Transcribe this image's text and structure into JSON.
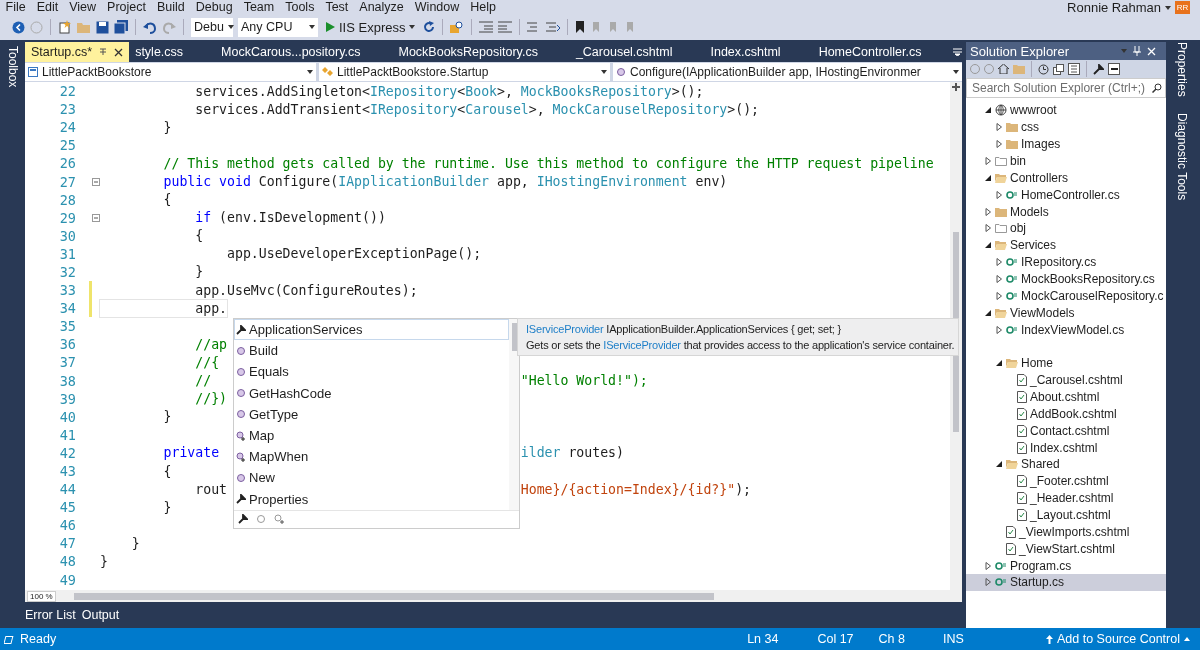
{
  "menu": [
    "File",
    "Edit",
    "View",
    "Project",
    "Build",
    "Debug",
    "Team",
    "Tools",
    "Test",
    "Analyze",
    "Window",
    "Help"
  ],
  "user": {
    "name": "Ronnie Rahman",
    "initials": "RR"
  },
  "toolbar": {
    "configuration": "Debu",
    "platform": "Any CPU",
    "run_target": "IIS Express"
  },
  "left_strip": [
    "Toolbox"
  ],
  "right_strip": [
    "Properties",
    "Diagnostic Tools"
  ],
  "tabs": [
    {
      "label": "Startup.cs*",
      "selected": true
    },
    {
      "label": "style.css",
      "selected": false
    },
    {
      "label": "MockCarous...pository.cs",
      "selected": false
    },
    {
      "label": "MockBooksRepository.cs",
      "selected": false
    },
    {
      "label": "_Carousel.cshtml",
      "selected": false
    },
    {
      "label": "Index.cshtml",
      "selected": false
    },
    {
      "label": "HomeController.cs",
      "selected": false
    }
  ],
  "nav_bar": [
    "LittlePacktBookstore",
    "LittlePacktBookstore.Startup",
    "Configure(IApplicationBuilder app, IHostingEnvironmer"
  ],
  "editor": {
    "zoom": "100 %",
    "lines": [
      {
        "number": "22",
        "changed": false,
        "fold": false,
        "current": false,
        "tokens": [
          {
            "text": "            services.AddSingleton<",
            "kind": "plain"
          },
          {
            "text": "IRepository",
            "kind": "type"
          },
          {
            "text": "<",
            "kind": "plain"
          },
          {
            "text": "Book",
            "kind": "type"
          },
          {
            "text": ">, ",
            "kind": "plain"
          },
          {
            "text": "MockBooksRepository",
            "kind": "type"
          },
          {
            "text": ">();",
            "kind": "plain"
          }
        ]
      },
      {
        "number": "23",
        "changed": false,
        "fold": false,
        "current": false,
        "tokens": [
          {
            "text": "            services.AddTransient<",
            "kind": "plain"
          },
          {
            "text": "IRepository",
            "kind": "type"
          },
          {
            "text": "<",
            "kind": "plain"
          },
          {
            "text": "Carousel",
            "kind": "type"
          },
          {
            "text": ">, ",
            "kind": "plain"
          },
          {
            "text": "MockCarouselRepository",
            "kind": "type"
          },
          {
            "text": ">();",
            "kind": "plain"
          }
        ]
      },
      {
        "number": "24",
        "changed": false,
        "fold": false,
        "current": false,
        "tokens": [
          {
            "text": "        }",
            "kind": "plain"
          }
        ]
      },
      {
        "number": "25",
        "changed": false,
        "fold": false,
        "current": false
      },
      {
        "number": "26",
        "changed": false,
        "fold": false,
        "current": false,
        "tokens": [
          {
            "text": "        // This method gets called by the runtime. Use this method to configure the HTTP request pipeline",
            "kind": "comment"
          }
        ]
      },
      {
        "number": "27",
        "changed": false,
        "fold": true,
        "current": false,
        "tokens": [
          {
            "text": "        public void",
            "kind": "keyword"
          },
          {
            "text": " Configure(",
            "kind": "plain"
          },
          {
            "text": "IApplicationBuilder",
            "kind": "type"
          },
          {
            "text": " app, ",
            "kind": "plain"
          },
          {
            "text": "IHostingEnvironment",
            "kind": "type"
          },
          {
            "text": " env)",
            "kind": "plain"
          }
        ]
      },
      {
        "number": "28",
        "changed": false,
        "fold": false,
        "current": false,
        "tokens": [
          {
            "text": "        {",
            "kind": "plain"
          }
        ]
      },
      {
        "number": "29",
        "changed": false,
        "fold": true,
        "current": false,
        "tokens": [
          {
            "text": "            if",
            "kind": "keyword"
          },
          {
            "text": " (env.IsDevelopment())",
            "kind": "plain"
          }
        ]
      },
      {
        "number": "30",
        "changed": false,
        "fold": false,
        "current": false,
        "tokens": [
          {
            "text": "            {",
            "kind": "plain"
          }
        ]
      },
      {
        "number": "31",
        "changed": false,
        "fold": false,
        "current": false,
        "tokens": [
          {
            "text": "                app.UseDeveloperExceptionPage();",
            "kind": "plain"
          }
        ]
      },
      {
        "number": "32",
        "changed": false,
        "fold": false,
        "current": false,
        "tokens": [
          {
            "text": "            }",
            "kind": "plain"
          }
        ]
      },
      {
        "number": "33",
        "changed": true,
        "fold": false,
        "current": false,
        "tokens": [
          {
            "text": "            app.UseMvc(ConfigureRoutes);",
            "kind": "plain"
          }
        ]
      },
      {
        "number": "34",
        "changed": true,
        "fold": false,
        "current": true,
        "tokens": [
          {
            "text": "            app.",
            "kind": "plain"
          }
        ]
      },
      {
        "number": "35",
        "changed": false,
        "fold": false,
        "current": false
      },
      {
        "number": "36",
        "changed": false,
        "fold": false,
        "current": false,
        "tokens": [
          {
            "text": "            //ap",
            "kind": "comment"
          }
        ]
      },
      {
        "number": "37",
        "changed": false,
        "fold": false,
        "current": false,
        "tokens": [
          {
            "text": "            //{",
            "kind": "comment"
          }
        ]
      },
      {
        "number": "38",
        "changed": false,
        "fold": false,
        "current": false,
        "tokens": [
          {
            "text": "            //",
            "kind": "comment"
          }
        ],
        "tail": [
          {
            "text": "\"Hello World!\");",
            "kind": "comment"
          }
        ]
      },
      {
        "number": "39",
        "changed": false,
        "fold": false,
        "current": false,
        "tokens": [
          {
            "text": "            //})",
            "kind": "comment"
          }
        ]
      },
      {
        "number": "40",
        "changed": false,
        "fold": false,
        "current": false,
        "tokens": [
          {
            "text": "        }",
            "kind": "plain"
          }
        ]
      },
      {
        "number": "41",
        "changed": false,
        "fold": false,
        "current": false
      },
      {
        "number": "42",
        "changed": false,
        "fold": false,
        "current": false,
        "tokens": [
          {
            "text": "        private",
            "kind": "keyword"
          }
        ],
        "tail": [
          {
            "text": "ilder",
            "kind": "type"
          },
          {
            "text": " routes)",
            "kind": "plain"
          }
        ]
      },
      {
        "number": "43",
        "changed": false,
        "fold": false,
        "current": false,
        "tokens": [
          {
            "text": "        {",
            "kind": "plain"
          }
        ]
      },
      {
        "number": "44",
        "changed": false,
        "fold": false,
        "current": false,
        "tokens": [
          {
            "text": "            rout",
            "kind": "plain"
          }
        ],
        "tail": [
          {
            "text": "Home}/{action=Index}/{id?}\"",
            "kind": "string"
          },
          {
            "text": ");",
            "kind": "plain"
          }
        ]
      },
      {
        "number": "45",
        "changed": false,
        "fold": false,
        "current": false,
        "tokens": [
          {
            "text": "        }",
            "kind": "plain"
          }
        ]
      },
      {
        "number": "46",
        "changed": false,
        "fold": false,
        "current": false
      },
      {
        "number": "47",
        "changed": false,
        "fold": false,
        "current": false,
        "tokens": [
          {
            "text": "    }",
            "kind": "plain"
          }
        ]
      },
      {
        "number": "48",
        "changed": false,
        "fold": false,
        "current": false,
        "tokens": [
          {
            "text": "}",
            "kind": "plain"
          }
        ]
      },
      {
        "number": "49",
        "changed": false,
        "fold": false,
        "current": false
      }
    ]
  },
  "completion": {
    "items": [
      {
        "label": "ApplicationServices",
        "kind": "property",
        "selected": true
      },
      {
        "label": "Build",
        "kind": "method",
        "selected": false
      },
      {
        "label": "Equals",
        "kind": "method",
        "selected": false
      },
      {
        "label": "GetHashCode",
        "kind": "method",
        "selected": false
      },
      {
        "label": "GetType",
        "kind": "method",
        "selected": false
      },
      {
        "label": "Map",
        "kind": "extension",
        "selected": false
      },
      {
        "label": "MapWhen",
        "kind": "extension",
        "selected": false
      },
      {
        "label": "New",
        "kind": "method",
        "selected": false
      },
      {
        "label": "Properties",
        "kind": "property",
        "selected": false
      }
    ]
  },
  "tooltip": {
    "signature": [
      {
        "text": "IServiceProvider",
        "kind": "type"
      },
      {
        "text": " IApplicationBuilder.ApplicationServices { get; set; }",
        "kind": "plain"
      }
    ],
    "description": [
      {
        "text": "Gets or sets the ",
        "kind": "plain"
      },
      {
        "text": "IServiceProvider",
        "kind": "type"
      },
      {
        "text": " that provides access to the application's service container.",
        "kind": "plain"
      }
    ]
  },
  "solution_explorer": {
    "title": "Solution Explorer",
    "search": {
      "placeholder": "Search Solution Explorer (Ctrl+;)"
    },
    "tree": [
      {
        "label": "wwwroot",
        "kind": "globe",
        "expanded": true,
        "selected": false,
        "children": [
          {
            "label": "css",
            "kind": "folder",
            "expanded": false,
            "selected": false
          },
          {
            "label": "Images",
            "kind": "folder",
            "expanded": false,
            "selected": false
          }
        ]
      },
      {
        "label": "bin",
        "kind": "hidden-folder",
        "expanded": false,
        "selected": false
      },
      {
        "label": "Controllers",
        "kind": "folder",
        "expanded": true,
        "selected": false,
        "children": [
          {
            "label": "HomeController.cs",
            "kind": "csharp",
            "expanded": false,
            "selected": false
          }
        ]
      },
      {
        "label": "Models",
        "kind": "folder",
        "expanded": false,
        "selected": false
      },
      {
        "label": "obj",
        "kind": "hidden-folder",
        "expanded": false,
        "selected": false
      },
      {
        "label": "Services",
        "kind": "folder",
        "expanded": true,
        "selected": false,
        "children": [
          {
            "label": "IRepository.cs",
            "kind": "csharp",
            "expanded": false,
            "selected": false
          },
          {
            "label": "MockBooksRepository.cs",
            "kind": "csharp",
            "expanded": false,
            "selected": false
          },
          {
            "label": "MockCarouselRepository.c",
            "kind": "csharp",
            "expanded": false,
            "selected": false
          }
        ]
      },
      {
        "label": "ViewModels",
        "kind": "folder",
        "expanded": true,
        "selected": false,
        "children": [
          {
            "label": "IndexViewModel.cs",
            "kind": "csharp",
            "expanded": false,
            "selected": false
          }
        ]
      },
      {
        "kind": "folder",
        "expanded": true,
        "selected": false,
        "children": [
          {
            "label": "Home",
            "kind": "folder",
            "expanded": true,
            "selected": false,
            "children": [
              {
                "label": "_Carousel.cshtml",
                "kind": "page",
                "expanded": false,
                "selected": false
              },
              {
                "label": "About.cshtml",
                "kind": "page",
                "expanded": false,
                "selected": false
              },
              {
                "label": "AddBook.cshtml",
                "kind": "page",
                "expanded": false,
                "selected": false
              },
              {
                "label": "Contact.cshtml",
                "kind": "page",
                "expanded": false,
                "selected": false
              },
              {
                "label": "Index.cshtml",
                "kind": "page",
                "expanded": false,
                "selected": false
              }
            ]
          },
          {
            "label": "Shared",
            "kind": "folder",
            "expanded": true,
            "selected": false,
            "children": [
              {
                "label": "_Footer.cshtml",
                "kind": "page",
                "expanded": false,
                "selected": false
              },
              {
                "label": "_Header.cshtml",
                "kind": "page",
                "expanded": false,
                "selected": false
              },
              {
                "label": "_Layout.cshtml",
                "kind": "page",
                "expanded": false,
                "selected": false
              }
            ]
          },
          {
            "label": "_ViewImports.cshtml",
            "kind": "page",
            "expanded": false,
            "selected": false
          },
          {
            "label": "_ViewStart.cshtml",
            "kind": "page",
            "expanded": false,
            "selected": false
          }
        ]
      },
      {
        "label": "Program.cs",
        "kind": "csharp",
        "expanded": false,
        "selected": false
      },
      {
        "label": "Startup.cs",
        "kind": "csharp",
        "expanded": false,
        "selected": true
      }
    ]
  },
  "bottom_tabs": [
    "Error List",
    "Output"
  ],
  "status_bar": {
    "message": "Ready",
    "line": "Ln 34",
    "column": "Col 17",
    "char": "Ch 8",
    "mode": "INS",
    "source_control": "Add to Source Control"
  }
}
